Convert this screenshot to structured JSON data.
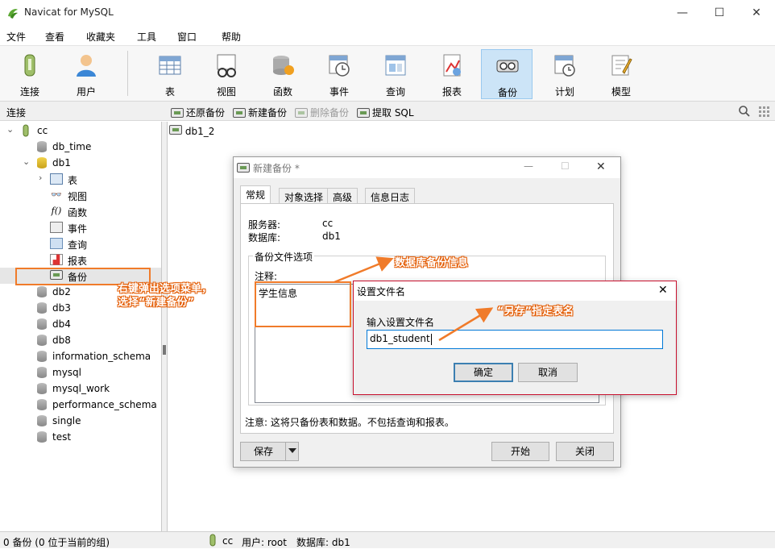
{
  "app": {
    "title": "Navicat for MySQL"
  },
  "window_controls": {
    "minimize": "—",
    "maximize": "☐",
    "close": "✕"
  },
  "menu": [
    "文件",
    "查看",
    "收藏夹",
    "工具",
    "窗口",
    "帮助"
  ],
  "toolbar": [
    {
      "label": "连接",
      "icon": "connection-icon"
    },
    {
      "label": "用户",
      "icon": "user-icon"
    },
    {
      "label": "表",
      "icon": "table-icon"
    },
    {
      "label": "视图",
      "icon": "view-icon"
    },
    {
      "label": "函数",
      "icon": "function-icon"
    },
    {
      "label": "事件",
      "icon": "event-icon"
    },
    {
      "label": "查询",
      "icon": "query-icon"
    },
    {
      "label": "报表",
      "icon": "report-icon"
    },
    {
      "label": "备份",
      "icon": "backup-icon",
      "active": true
    },
    {
      "label": "计划",
      "icon": "schedule-icon"
    },
    {
      "label": "模型",
      "icon": "model-icon"
    }
  ],
  "subbar": {
    "connection_label": "连接",
    "restore": "还原备份",
    "new_backup": "新建备份",
    "delete_backup": "删除备份",
    "extract_sql": "提取 SQL"
  },
  "tree": {
    "connection": "cc",
    "databases_before": [
      "db_time"
    ],
    "open_db": "db1",
    "children": [
      "表",
      "视图",
      "函数",
      "事件",
      "查询",
      "报表",
      "备份"
    ],
    "databases_after": [
      "db2",
      "db3",
      "db4",
      "db8",
      "information_schema",
      "mysql",
      "mysql_work",
      "performance_schema",
      "single",
      "test"
    ]
  },
  "content": {
    "item": "db1_2"
  },
  "status": {
    "left": "0 备份 (0 位于当前的组)",
    "connection": "cc",
    "user": "用户: root",
    "database": "数据库: db1"
  },
  "backup_dialog": {
    "title": "新建备份 *",
    "tabs": [
      "常规",
      "对象选择",
      "高级",
      "信息日志"
    ],
    "server_label": "服务器:",
    "server_value": "cc",
    "database_label": "数据库:",
    "database_value": "db1",
    "group_label": "备份文件选项",
    "comment_label": "注释:",
    "comment_value": "学生信息",
    "note": "注意: 这将只备份表和数据。不包括查询和报表。",
    "save_button": "保存",
    "start_button": "开始",
    "close_button": "关闭"
  },
  "filename_dialog": {
    "title": "设置文件名",
    "prompt": "输入设置文件名",
    "value": "db1_student",
    "ok": "确定",
    "cancel": "取消"
  },
  "annotations": {
    "right_click_line1": "右键弹出选项菜单，",
    "right_click_line2": "选择“新建备份”",
    "db_backup_info": "数据库备份信息",
    "save_as": "“另存”指定表名",
    "color": "#f07b2a"
  }
}
